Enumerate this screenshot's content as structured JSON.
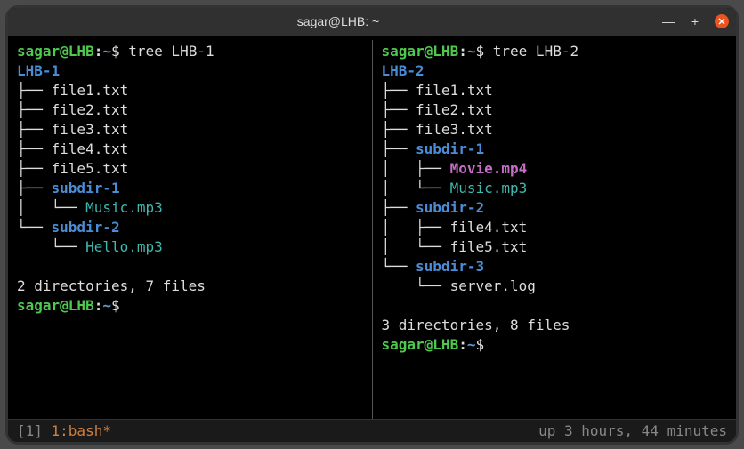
{
  "titlebar": {
    "title": "sagar@LHB: ~"
  },
  "prompt": {
    "user": "sagar@LHB",
    "colon": ":",
    "path": "~",
    "dollar": "$"
  },
  "left": {
    "command": "tree LHB-1",
    "root": "LHB-1",
    "lines": [
      {
        "pipe": "├── ",
        "name": "file1.txt",
        "cls": "file"
      },
      {
        "pipe": "├── ",
        "name": "file2.txt",
        "cls": "file"
      },
      {
        "pipe": "├── ",
        "name": "file3.txt",
        "cls": "file"
      },
      {
        "pipe": "├── ",
        "name": "file4.txt",
        "cls": "file"
      },
      {
        "pipe": "├── ",
        "name": "file5.txt",
        "cls": "file"
      },
      {
        "pipe": "├── ",
        "name": "subdir-1",
        "cls": "dir"
      },
      {
        "pipe": "│   └── ",
        "name": "Music.mp3",
        "cls": "media-audio"
      },
      {
        "pipe": "└── ",
        "name": "subdir-2",
        "cls": "dir"
      },
      {
        "pipe": "    └── ",
        "name": "Hello.mp3",
        "cls": "media-audio"
      }
    ],
    "summary": "2 directories, 7 files"
  },
  "right": {
    "command": "tree LHB-2",
    "root": "LHB-2",
    "lines": [
      {
        "pipe": "├── ",
        "name": "file1.txt",
        "cls": "file"
      },
      {
        "pipe": "├── ",
        "name": "file2.txt",
        "cls": "file"
      },
      {
        "pipe": "├── ",
        "name": "file3.txt",
        "cls": "file"
      },
      {
        "pipe": "├── ",
        "name": "subdir-1",
        "cls": "dir"
      },
      {
        "pipe": "│   ├── ",
        "name": "Movie.mp4",
        "cls": "media-video"
      },
      {
        "pipe": "│   └── ",
        "name": "Music.mp3",
        "cls": "media-audio"
      },
      {
        "pipe": "├── ",
        "name": "subdir-2",
        "cls": "dir"
      },
      {
        "pipe": "│   ├── ",
        "name": "file4.txt",
        "cls": "file"
      },
      {
        "pipe": "│   └── ",
        "name": "file5.txt",
        "cls": "file"
      },
      {
        "pipe": "└── ",
        "name": "subdir-3",
        "cls": "dir"
      },
      {
        "pipe": "    └── ",
        "name": "server.log",
        "cls": "file"
      }
    ],
    "summary": "3 directories, 8 files"
  },
  "statusbar": {
    "winnum": "[1] ",
    "tab": "1:bash*",
    "uptime": "up 3 hours, 44 minutes"
  }
}
